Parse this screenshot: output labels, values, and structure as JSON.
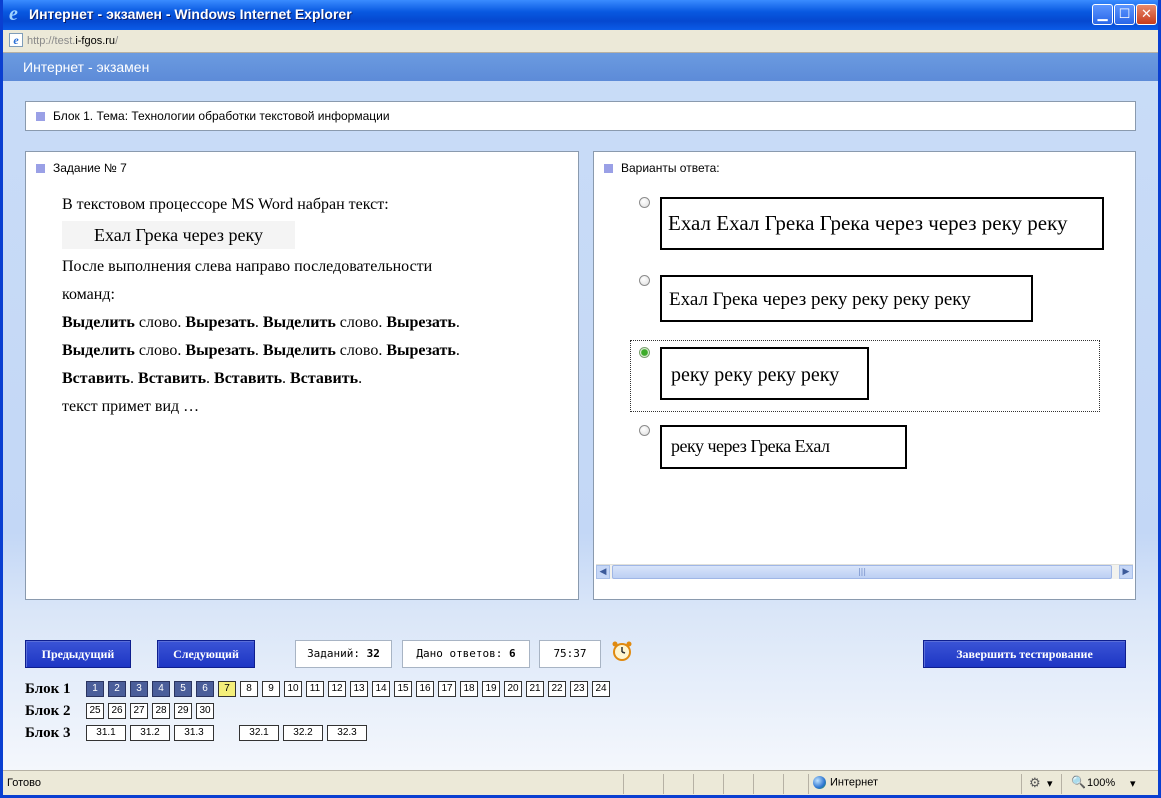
{
  "window": {
    "title": "Интернет - экзамен - Windows Internet Explorer",
    "url_prefix": "http://test.",
    "url_host": "i-fgos.ru",
    "url_suffix": "/",
    "min_symbol": "▁",
    "max_symbol": "☐",
    "close_symbol": "✕"
  },
  "header": {
    "title": "Интернет - экзамен"
  },
  "block": {
    "label": "Блок 1. Тема: Технологии обработки текстовой информации"
  },
  "task": {
    "label": "Задание № 7",
    "line1": "В текстовом процессоре MS Word набран текст:",
    "phrase": "Ехал Грека через реку",
    "line2a": "После выполнения слева направо последовательности",
    "line2b": "команд:",
    "cmd_select": "Выделить",
    "cmd_word": "слово.",
    "cmd_cut": "Вырезать",
    "cmd_paste": "Вставить",
    "dot": ".",
    "line_end": "текст примет вид …"
  },
  "answers": {
    "label": "Варианты ответа:",
    "options": [
      {
        "text": "Ехал Ехал Грека Грека через через реку реку",
        "selected": false
      },
      {
        "text": "Ехал Грека через реку реку реку реку",
        "selected": false
      },
      {
        "text": "реку реку реку реку",
        "selected": true
      },
      {
        "text": "реку через Грека Ехал",
        "selected": false
      }
    ]
  },
  "controls": {
    "prev": "Предыдущий",
    "next": "Следующий",
    "tasks_label": "Заданий:",
    "tasks_count": "32",
    "answered_label": "Дано ответов:",
    "answered_count": "6",
    "timer": "75:37",
    "finish": "Завершить тестирование"
  },
  "navigator": {
    "block1_label": "Блок 1",
    "block2_label": "Блок 2",
    "block3_label": "Блок 3",
    "block1": [
      "1",
      "2",
      "3",
      "4",
      "5",
      "6",
      "7",
      "8",
      "9",
      "10",
      "11",
      "12",
      "13",
      "14",
      "15",
      "16",
      "17",
      "18",
      "19",
      "20",
      "21",
      "22",
      "23",
      "24"
    ],
    "block1_done": 6,
    "block1_current": "7",
    "block2": [
      "25",
      "26",
      "27",
      "28",
      "29",
      "30"
    ],
    "block3a": [
      "31.1",
      "31.2",
      "31.3"
    ],
    "block3b": [
      "32.1",
      "32.2",
      "32.3"
    ]
  },
  "status": {
    "ready": "Готово",
    "zone": "Интернет",
    "zoom": "100%",
    "dropdown": "▾"
  }
}
